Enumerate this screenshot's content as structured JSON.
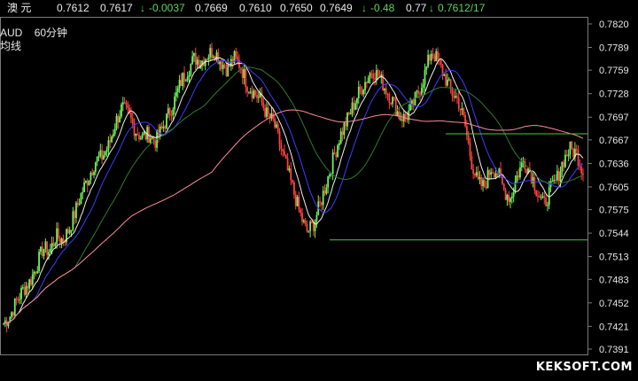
{
  "topbar": {
    "name": "澳   元",
    "open": "0.7612",
    "price": "0.7617",
    "change": "-0.0037",
    "high": "0.7669",
    "low": "0.7610",
    "v1": "0.7650",
    "v2": "0.7649",
    "pct": "-0.48",
    "v3": "0.77",
    "v4": "0.7612/17"
  },
  "labels": {
    "symbol": "AUD",
    "period": "60分钟",
    "ma": "均线",
    "watermark": "KEKSOFT.COM"
  },
  "colors": {
    "grid_border": "#7a7a7a",
    "bull": "#6cf25a",
    "bear": "#ff4040",
    "ma_white": "#f0f0f0",
    "ma_blue": "#3b3bff",
    "ma_green": "#2f7a2f",
    "ma_pink": "#ff8a9a",
    "hline": "#3ecf3e"
  },
  "chart_data": {
    "type": "candlestick",
    "title": "",
    "ylim": [
      0.7375,
      0.78
    ],
    "y_ticks": [
      "0.7820",
      "0.7789",
      "0.7759",
      "0.7728",
      "0.7697",
      "0.7667",
      "0.7636",
      "0.7605",
      "0.7575",
      "0.7544",
      "0.7513",
      "0.7483",
      "0.7452",
      "0.7421",
      "0.7391"
    ],
    "y_tick_values": [
      0.782,
      0.7789,
      0.7759,
      0.7728,
      0.7697,
      0.7667,
      0.7636,
      0.7605,
      0.7575,
      0.7544,
      0.7513,
      0.7483,
      0.7452,
      0.7421,
      0.7391
    ],
    "close_path": [
      0.7425,
      0.7435,
      0.7455,
      0.747,
      0.748,
      0.75,
      0.7525,
      0.752,
      0.754,
      0.7535,
      0.755,
      0.7575,
      0.76,
      0.762,
      0.764,
      0.7645,
      0.766,
      0.769,
      0.771,
      0.77,
      0.768,
      0.767,
      0.7675,
      0.7665,
      0.768,
      0.77,
      0.772,
      0.7745,
      0.776,
      0.7775,
      0.777,
      0.778,
      0.7785,
      0.777,
      0.776,
      0.7775,
      0.7765,
      0.774,
      0.773,
      0.772,
      0.77,
      0.769,
      0.766,
      0.763,
      0.76,
      0.757,
      0.7545,
      0.7555,
      0.758,
      0.761,
      0.764,
      0.767,
      0.769,
      0.771,
      0.773,
      0.7745,
      0.776,
      0.775,
      0.7735,
      0.772,
      0.77,
      0.7695,
      0.771,
      0.773,
      0.7755,
      0.7785,
      0.777,
      0.775,
      0.773,
      0.772,
      0.769,
      0.764,
      0.761,
      0.7605,
      0.763,
      0.7625,
      0.76,
      0.759,
      0.762,
      0.764,
      0.7625,
      0.76,
      0.758,
      0.76,
      0.7615,
      0.764,
      0.7655,
      0.765,
      0.7625
    ],
    "horizontal_lines": [
      0.7675,
      0.7535
    ],
    "moving_averages": [
      "white",
      "blue",
      "green",
      "pink"
    ]
  }
}
